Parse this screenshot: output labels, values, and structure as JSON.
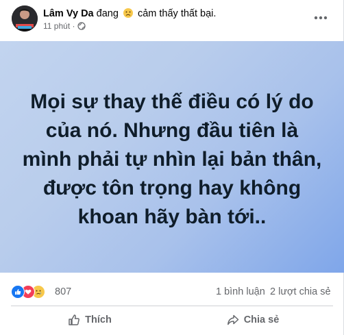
{
  "post": {
    "author": "Lâm Vy Da",
    "feeling_prefix": " đang ",
    "feeling_text": " cảm thấy thất bại.",
    "time": "11 phút",
    "meta_sep": " · ",
    "privacy_icon": "globe-icon",
    "more_icon": "more-options-icon",
    "text": "Mọi sự thay thế điều có lý do của nó. Nhưng đầu tiên là mình phải tự nhìn lại bản thân, được tôn trọng hay không khoan hãy bàn tới..",
    "background_colors": [
      "#c2d4ef",
      "#7fa6ea"
    ]
  },
  "reactions": {
    "icons": [
      "like-icon",
      "love-icon",
      "sad-icon"
    ],
    "count": "807",
    "comments": "1 bình luận",
    "shares": "2 lượt chia sẻ"
  },
  "actions": {
    "like_label": "Thích",
    "share_label": "Chia sẻ"
  },
  "colors": {
    "like_blue": "#1877f2",
    "love_red": "#f33e58",
    "sad_yellow": "#f7c84b",
    "secondary_text": "#65676b"
  }
}
